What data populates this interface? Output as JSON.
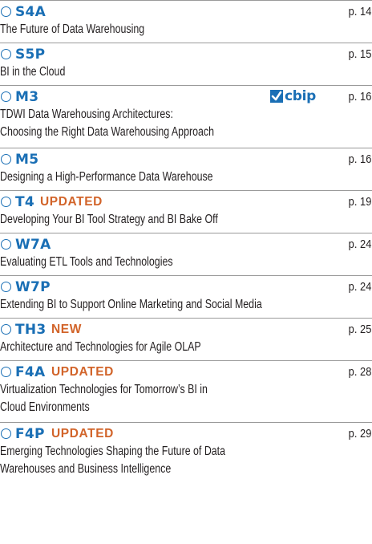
{
  "courses": [
    {
      "code": "S4A",
      "badge": "",
      "page": "p. 14",
      "title_lines": [
        "The Future of Data Warehousing"
      ]
    },
    {
      "code": "S5P",
      "badge": "",
      "page": "p. 15",
      "title_lines": [
        "BI in the Cloud"
      ]
    },
    {
      "code": "M3",
      "badge": "",
      "page": "p. 16",
      "logo": "cbip",
      "title_lines": [
        "TDWI Data Warehousing Architectures:",
        "Choosing the Right Data Warehousing Approach"
      ]
    },
    {
      "code": "M5",
      "badge": "",
      "page": "p. 16",
      "title_lines": [
        "Designing a High-Performance Data Warehouse"
      ]
    },
    {
      "code": "T4",
      "badge": "UPDATED",
      "page": "p. 19",
      "title_lines": [
        "Developing Your BI Tool Strategy and BI Bake Off"
      ]
    },
    {
      "code": "W7A",
      "badge": "",
      "page": "p. 24",
      "title_lines": [
        "Evaluating ETL Tools and Technologies"
      ]
    },
    {
      "code": "W7P",
      "badge": "",
      "page": "p. 24",
      "title_lines": [
        "Extending BI to Support Online Marketing and Social Media"
      ]
    },
    {
      "code": "TH3",
      "badge": "NEW",
      "page": "p. 25",
      "title_lines": [
        "Architecture and Technologies for Agile OLAP"
      ]
    },
    {
      "code": "F4A",
      "badge": "UPDATED",
      "page": "p. 28",
      "title_lines": [
        "Virtualization Technologies for Tomorrow’s BI in",
        "Cloud Environments"
      ]
    },
    {
      "code": "F4P",
      "badge": "UPDATED",
      "page": "p. 29",
      "title_lines": [
        "Emerging Technologies Shaping the Future of Data",
        "Warehouses and Business Intelligence"
      ]
    }
  ],
  "logo_text": "cbip",
  "icons": {
    "select": "circle-checkbox-icon",
    "logo": "cbip-checkmark-icon"
  },
  "colors": {
    "code": "#1a6fb5",
    "badge": "#d2642a",
    "text": "#231f20",
    "rule": "#9a9a9a"
  }
}
